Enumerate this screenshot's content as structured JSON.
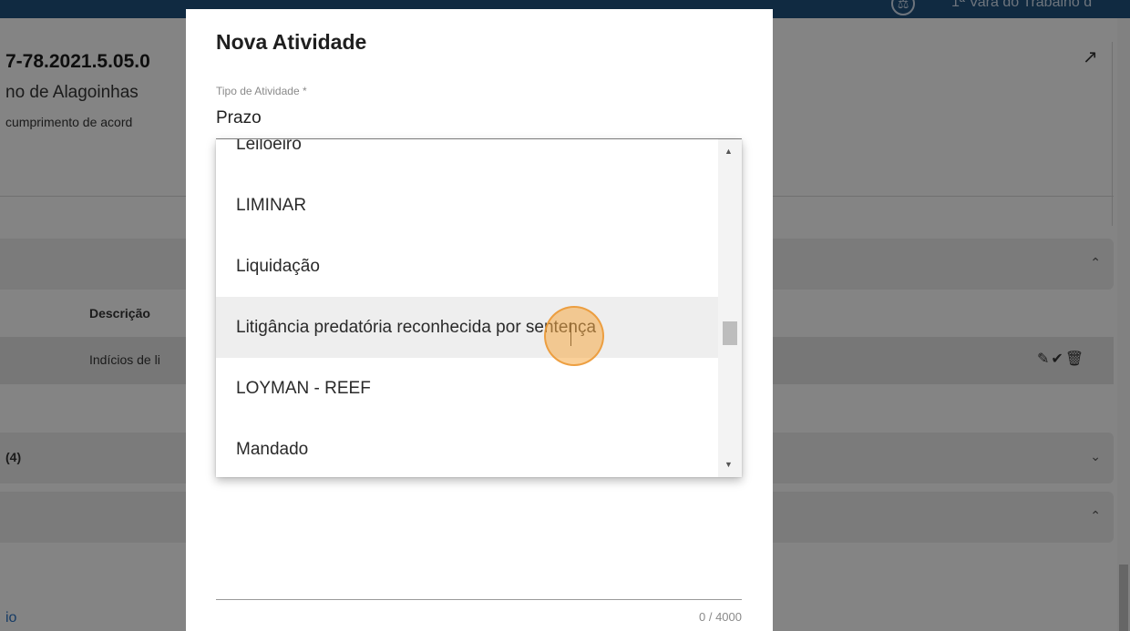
{
  "background": {
    "topbar_text": "1ª Vara do Trabalho d",
    "process": {
      "number": "7-78.2021.5.05.0",
      "court": "no de Alagoinhas",
      "class": "cumprimento de acord"
    },
    "table": {
      "header_description": "Descrição",
      "row_description": "Indícios de li",
      "row_actions": "✎✔🗑"
    },
    "panel_label": "(4)",
    "link": "io",
    "icons": {
      "open_external": "↗",
      "chevron_up": "⌃",
      "chevron_down": "⌄"
    }
  },
  "modal": {
    "title": "Nova Atividade",
    "field_label": "Tipo de Atividade *",
    "field_value": "Prazo",
    "char_count": "0 / 4000",
    "dropdown": {
      "options": [
        "Leiloeiro",
        "LIMINAR",
        "Liquidação",
        "Litigância predatória reconhecida por sentença",
        "LOYMAN - REEF",
        "Mandado"
      ],
      "hovered_option": "Litigância predatória reconhecida por sentença",
      "scroll_up_icon": "▲",
      "scroll_down_icon": "▼"
    }
  },
  "colors": {
    "topbar": "#1f4e79",
    "overlay": "rgba(0,0,0,0.46)",
    "click_indicator": "#f5aa46"
  }
}
